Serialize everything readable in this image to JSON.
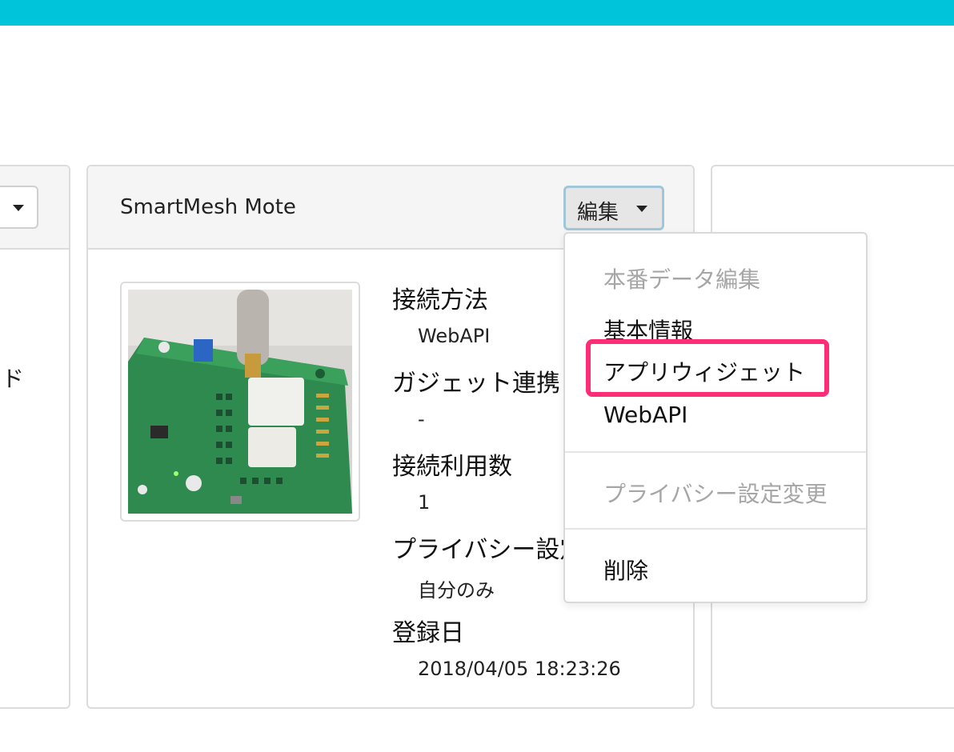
{
  "header": {
    "accent_color": "#00c4d9"
  },
  "left_card": {
    "snippet": "ド"
  },
  "device": {
    "title": "SmartMesh Mote",
    "image_alt": "SmartMesh mote board photo",
    "edit_button": "編集",
    "fields": [
      {
        "label": "接続方法",
        "value": "WebAPI"
      },
      {
        "label": "ガジェット連携",
        "value": "-"
      },
      {
        "label": "接続利用数",
        "value": "1"
      },
      {
        "label": "プライバシー設定",
        "value": "自分のみ"
      },
      {
        "label": "登録日",
        "value": "2018/04/05 18:23:26"
      }
    ]
  },
  "dropdown": {
    "section_header": "本番データ編集",
    "basic_info": "基本情報",
    "app_widget": "アプリウィジェット",
    "webapi": "WebAPI",
    "privacy_change": "プライバシー設定変更",
    "delete": "削除",
    "highlight_color": "#ff2d78"
  }
}
